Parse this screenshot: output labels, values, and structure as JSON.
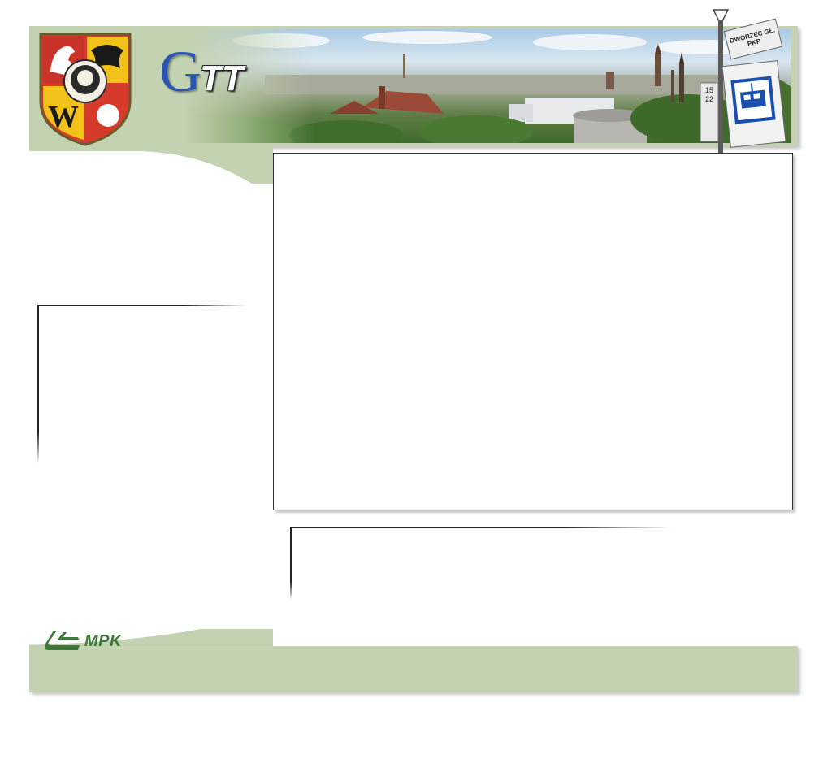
{
  "header": {
    "logo_letter_g": "G",
    "logo_letters_tt": "TT",
    "stop_sign_text": "DWORZEC GŁ. PKP",
    "stop_lines": "15\n22",
    "crest_letter": "W"
  },
  "footer": {
    "operator_logo": "MPK"
  },
  "colors": {
    "panel_green": "#c3d2b0",
    "logo_blue": "#2b55b5",
    "mpk_green": "#3f7a3a",
    "border": "#333333"
  },
  "icons": [
    "coat-of-arms-icon",
    "tram-stop-sign-icon",
    "tram-icon",
    "mpk-logo-icon"
  ]
}
